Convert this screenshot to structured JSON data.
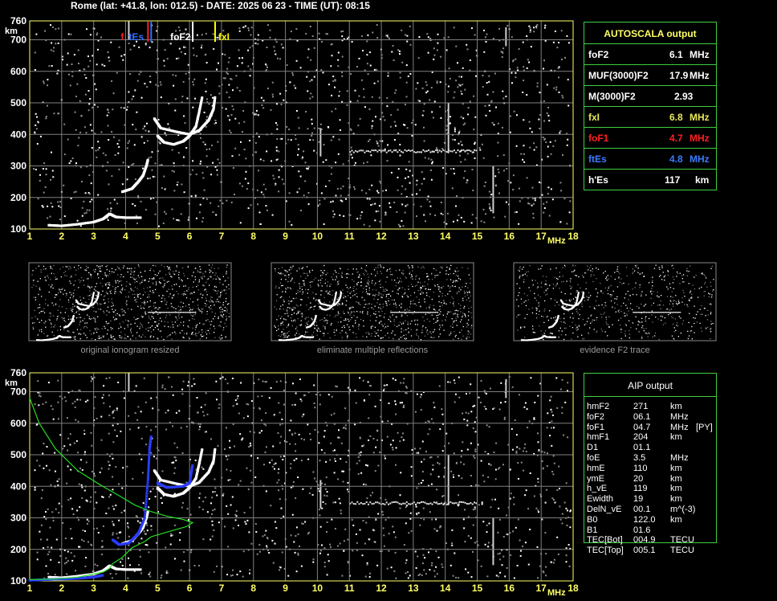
{
  "header": "Rome (lat: +41.8, lon: 012.5) - DATE: 2025 06 23 - TIME (UT): 08:15",
  "colors": {
    "grid": "#7f7f7f",
    "frame": "#ffff66",
    "box": "#3fcf3f",
    "green_profile": "#22dd22",
    "fxl": "#ffff00",
    "fof1": "#ff2020",
    "ftes": "#3070ff",
    "blue_trace": "#2a3cff"
  },
  "chart_data": [
    {
      "type": "scatter",
      "name_id": "top-ionogram",
      "x_ticks": [
        "1",
        "2",
        "3",
        "4",
        "5",
        "6",
        "7",
        "8",
        "9",
        "10",
        "11",
        "12",
        "13",
        "14",
        "15",
        "16",
        "17",
        "18"
      ],
      "y_ticks": [
        "100",
        "200",
        "300",
        "400",
        "500",
        "600",
        "700",
        "760"
      ],
      "xunit": "MHz",
      "yunit": "km",
      "xlim": [
        1,
        18
      ],
      "ylim": [
        100,
        760
      ],
      "grid": true,
      "markers": [
        {
          "label": "foF2",
          "x": 6.1,
          "color": "#ffffff"
        },
        {
          "label": "fxI",
          "x": 6.8,
          "color": "#ffff00"
        },
        {
          "label": "foF1",
          "x": 4.7,
          "color": "#ff2020"
        },
        {
          "label": "ftEs",
          "x": 4.8,
          "color": "#3070ff"
        }
      ],
      "marker_labels": {
        "f": "f",
        "tEs": "tEs"
      },
      "traces": [
        {
          "name": "E/Es",
          "points": [
            [
              1.6,
              112
            ],
            [
              2.0,
              110
            ],
            [
              2.5,
              115
            ],
            [
              3.0,
              122
            ],
            [
              3.3,
              132
            ],
            [
              3.5,
              148
            ],
            [
              3.7,
              138
            ],
            [
              4.0,
              136
            ],
            [
              4.5,
              136
            ]
          ]
        },
        {
          "name": "F1",
          "points": [
            [
              3.9,
              218
            ],
            [
              4.2,
              228
            ],
            [
              4.4,
              250
            ],
            [
              4.55,
              270
            ],
            [
              4.65,
              300
            ],
            [
              4.7,
              320
            ]
          ]
        },
        {
          "name": "F2o",
          "points": [
            [
              5.0,
              395
            ],
            [
              5.2,
              375
            ],
            [
              5.5,
              368
            ],
            [
              5.8,
              378
            ],
            [
              6.0,
              395
            ],
            [
              6.2,
              425
            ],
            [
              6.3,
              470
            ],
            [
              6.4,
              520
            ]
          ]
        },
        {
          "name": "F2x",
          "points": [
            [
              4.9,
              450
            ],
            [
              5.1,
              420
            ],
            [
              5.6,
              408
            ],
            [
              6.0,
              400
            ],
            [
              6.3,
              412
            ],
            [
              6.6,
              445
            ],
            [
              6.75,
              480
            ],
            [
              6.8,
              520
            ]
          ]
        }
      ]
    },
    {
      "type": "scatter",
      "name_id": "bottom-ionogram",
      "x_ticks": [
        "1",
        "2",
        "3",
        "4",
        "5",
        "6",
        "7",
        "8",
        "9",
        "10",
        "11",
        "12",
        "13",
        "14",
        "15",
        "16",
        "17",
        "18"
      ],
      "y_ticks": [
        "100",
        "200",
        "300",
        "400",
        "500",
        "600",
        "700",
        "760"
      ],
      "xunit": "MHz",
      "yunit": "km",
      "xlim": [
        1,
        18
      ],
      "ylim": [
        100,
        760
      ],
      "grid": true,
      "profile": [
        [
          1.0,
          680
        ],
        [
          1.3,
          600
        ],
        [
          1.8,
          520
        ],
        [
          2.5,
          450
        ],
        [
          3.2,
          405
        ],
        [
          3.8,
          370
        ],
        [
          4.3,
          340
        ],
        [
          4.8,
          320
        ],
        [
          5.3,
          305
        ],
        [
          5.8,
          295
        ],
        [
          6.1,
          285
        ],
        [
          5.9,
          272
        ],
        [
          5.3,
          255
        ],
        [
          4.8,
          240
        ],
        [
          4.6,
          225
        ],
        [
          4.2,
          205
        ],
        [
          3.9,
          175
        ],
        [
          3.6,
          155
        ],
        [
          3.5,
          140
        ],
        [
          3.3,
          128
        ],
        [
          2.5,
          112
        ],
        [
          1.8,
          106
        ],
        [
          1.0,
          104
        ]
      ]
    }
  ],
  "captions": [
    "original ionogram resized",
    "eliminate multiple reflections",
    "evidence F2 trace"
  ],
  "autoscala": {
    "title": "AUTOSCALA output",
    "rows": [
      {
        "label": "foF2",
        "value": "6.1",
        "unit": "MHz",
        "color": "#ffffff"
      },
      {
        "label": "MUF(3000)F2",
        "value": "17.9",
        "unit": "MHz",
        "color": "#ffffff"
      },
      {
        "label": "M(3000)F2",
        "value": "2.93",
        "unit": "",
        "color": "#ffffff"
      },
      {
        "label": "fxI",
        "value": "6.8",
        "unit": "MHz",
        "color": "#e8e85a"
      },
      {
        "label": "foF1",
        "value": "4.7",
        "unit": "MHz",
        "color": "#ff2020"
      },
      {
        "label": "ftEs",
        "value": "4.8",
        "unit": "MHz",
        "color": "#3a7cff"
      },
      {
        "label": "h'Es",
        "value": "117",
        "unit": "km",
        "color": "#ffffff"
      }
    ]
  },
  "aip": {
    "title": "AIP output",
    "rows": [
      [
        "hmF2",
        "271",
        "km",
        ""
      ],
      [
        "foF2",
        "06.1",
        "MHz",
        ""
      ],
      [
        "foF1",
        "04.7",
        "MHz",
        "[PY]"
      ],
      [
        "hmF1",
        "204",
        "km",
        ""
      ],
      [
        "D1",
        "01.1",
        "",
        ""
      ],
      [
        "foE",
        "3.5",
        "MHz",
        ""
      ],
      [
        "hmE",
        "110",
        "km",
        ""
      ],
      [
        "ymE",
        "20",
        "km",
        ""
      ],
      [
        "h_vE",
        "119",
        "km",
        ""
      ],
      [
        "Ewidth",
        "19",
        "km",
        ""
      ],
      [
        "DelN_vE",
        "00.1",
        "m^(-3)",
        ""
      ],
      [
        "B0",
        "122.0",
        "km",
        ""
      ],
      [
        "B1",
        "01.6",
        "",
        ""
      ],
      [
        "TEC[Bot]",
        "004.9",
        "TECU",
        ""
      ],
      [
        "TEC[Top]",
        "005.1",
        "TECU",
        ""
      ]
    ]
  }
}
